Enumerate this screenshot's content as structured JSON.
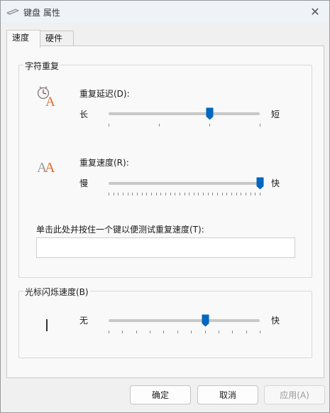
{
  "window": {
    "title": "键盘 属性",
    "close_label": "✕"
  },
  "tabs": [
    {
      "label": "速度",
      "active": true
    },
    {
      "label": "硬件",
      "active": false
    }
  ],
  "repeat_group": {
    "title": "字符重复",
    "delay": {
      "label": "重复延迟(D):",
      "min_label": "长",
      "max_label": "短",
      "value_fraction": 0.67
    },
    "rate": {
      "label": "重复速度(R):",
      "min_label": "慢",
      "max_label": "快",
      "value_fraction": 1.0
    },
    "test": {
      "label": "单击此处并按住一个键以便测试重复速度(T):",
      "value": ""
    }
  },
  "blink_group": {
    "title": "光标闪烁速度(B)",
    "min_label": "无",
    "max_label": "快",
    "value_fraction": 0.64
  },
  "buttons": {
    "ok": "确定",
    "cancel": "取消",
    "apply": "应用(A)"
  },
  "colors": {
    "accent": "#0067c0",
    "icon_orange": "#e36c2d"
  }
}
